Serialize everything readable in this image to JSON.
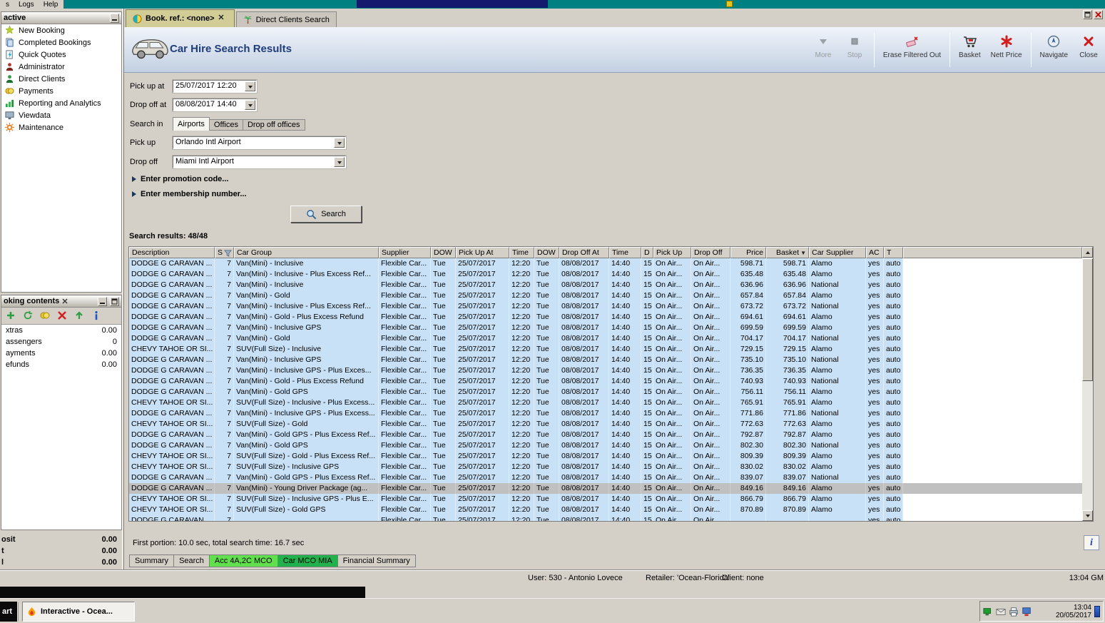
{
  "desktop": {
    "menu": [
      "s",
      "Logs",
      "Help"
    ]
  },
  "window": {
    "controls": [
      "restore-icon",
      "window-close-icon"
    ]
  },
  "tabs": [
    {
      "label": "Book. ref.: <none>",
      "icon": "globe-icon",
      "close_icon": "close-x-icon",
      "active": true
    },
    {
      "label": "Direct Clients Search",
      "icon": "palm-icon",
      "active": false
    }
  ],
  "header": {
    "title": "Car Hire Search Results",
    "image": "car-icon",
    "toolbar": [
      {
        "label": "More",
        "icon": "more-icon",
        "disabled": true
      },
      {
        "label": "Stop",
        "icon": "stop-icon",
        "disabled": true,
        "sep_after": true
      },
      {
        "label": "Erase Filtered Out",
        "icon": "eraser-icon",
        "sep_after": true
      },
      {
        "label": "Basket",
        "icon": "basket-icon"
      },
      {
        "label": "Nett Price",
        "icon": "nett-price-icon",
        "sep_after": true
      },
      {
        "label": "Navigate",
        "icon": "navigate-icon"
      },
      {
        "label": "Close",
        "icon": "close-icon"
      }
    ]
  },
  "form": {
    "pickup_at_label": "Pick up at",
    "pickup_at_value": "25/07/2017 12:20",
    "dropoff_at_label": "Drop off at",
    "dropoff_at_value": "08/08/2017 14:40",
    "search_in_label": "Search in",
    "search_in_tabs": [
      "Airports",
      "Offices",
      "Drop off offices"
    ],
    "search_in_active": 0,
    "pickup_label": "Pick up",
    "pickup_value": "Orlando Intl Airport",
    "dropoff_label": "Drop off",
    "dropoff_value": "Miami Intl Airport",
    "promotion_expander": "Enter promotion code...",
    "membership_expander": "Enter membership number...",
    "search_button": "Search",
    "search_button_icon": "search-icon"
  },
  "results": {
    "summary": "Search results: 48/48",
    "status": "First portion: 10.0 sec, total search time: 16.7 sec",
    "columns": [
      {
        "label": "Description"
      },
      {
        "label": "S",
        "icon": "filter-icon"
      },
      {
        "label": "Car Group"
      },
      {
        "label": "Supplier"
      },
      {
        "label": "DOW"
      },
      {
        "label": "Pick Up At"
      },
      {
        "label": "Time"
      },
      {
        "label": "DOW"
      },
      {
        "label": "Drop Off At"
      },
      {
        "label": "Time"
      },
      {
        "label": "D"
      },
      {
        "label": "Pick Up"
      },
      {
        "label": "Drop Off"
      },
      {
        "label": "Price",
        "align": "right"
      },
      {
        "label": "Basket",
        "align": "right",
        "sort": "desc"
      },
      {
        "label": "Car Supplier"
      },
      {
        "label": "AC"
      },
      {
        "label": "T"
      }
    ],
    "shared": {
      "seats": "7",
      "supplier": "Flexible Car...",
      "pickup_dow": "Tue",
      "pickup_date": "25/07/2017",
      "pickup_time": "12:20",
      "dropoff_dow": "Tue",
      "dropoff_date": "08/08/2017",
      "dropoff_time": "14:40",
      "days": "15",
      "pickup_location": "On Air...",
      "dropoff_location": "On Air...",
      "ac": "yes",
      "transmission": "auto"
    },
    "rows": [
      {
        "desc": "DODGE G CARAVAN ...",
        "group": "Van(Mini) - Inclusive",
        "price": "598.71",
        "basket": "598.71",
        "car": "Alamo"
      },
      {
        "desc": "DODGE G CARAVAN ...",
        "group": "Van(Mini) - Inclusive - Plus Excess Ref...",
        "price": "635.48",
        "basket": "635.48",
        "car": "Alamo"
      },
      {
        "desc": "DODGE G CARAVAN ...",
        "group": "Van(Mini) - Inclusive",
        "price": "636.96",
        "basket": "636.96",
        "car": "National"
      },
      {
        "desc": "DODGE G CARAVAN ...",
        "group": "Van(Mini) - Gold",
        "price": "657.84",
        "basket": "657.84",
        "car": "Alamo"
      },
      {
        "desc": "DODGE G CARAVAN ...",
        "group": "Van(Mini) - Inclusive - Plus Excess Ref...",
        "price": "673.72",
        "basket": "673.72",
        "car": "National"
      },
      {
        "desc": "DODGE G CARAVAN ...",
        "group": "Van(Mini) - Gold - Plus Excess Refund",
        "price": "694.61",
        "basket": "694.61",
        "car": "Alamo"
      },
      {
        "desc": "DODGE G CARAVAN ...",
        "group": "Van(Mini) - Inclusive GPS",
        "price": "699.59",
        "basket": "699.59",
        "car": "Alamo"
      },
      {
        "desc": "DODGE G CARAVAN ...",
        "group": "Van(Mini) - Gold",
        "price": "704.17",
        "basket": "704.17",
        "car": "National"
      },
      {
        "desc": "CHEVY TAHOE OR SI...",
        "group": "SUV(Full Size) - Inclusive",
        "price": "729.15",
        "basket": "729.15",
        "car": "Alamo"
      },
      {
        "desc": "DODGE G CARAVAN ...",
        "group": "Van(Mini) - Inclusive GPS",
        "price": "735.10",
        "basket": "735.10",
        "car": "National"
      },
      {
        "desc": "DODGE G CARAVAN ...",
        "group": "Van(Mini) - Inclusive GPS - Plus Exces...",
        "price": "736.35",
        "basket": "736.35",
        "car": "Alamo"
      },
      {
        "desc": "DODGE G CARAVAN ...",
        "group": "Van(Mini) - Gold - Plus Excess Refund",
        "price": "740.93",
        "basket": "740.93",
        "car": "National"
      },
      {
        "desc": "DODGE G CARAVAN ...",
        "group": "Van(Mini) - Gold GPS",
        "price": "756.11",
        "basket": "756.11",
        "car": "Alamo"
      },
      {
        "desc": "CHEVY TAHOE OR SI...",
        "group": "SUV(Full Size) - Inclusive - Plus Excess...",
        "price": "765.91",
        "basket": "765.91",
        "car": "Alamo"
      },
      {
        "desc": "DODGE G CARAVAN ...",
        "group": "Van(Mini) - Inclusive GPS - Plus Excess...",
        "price": "771.86",
        "basket": "771.86",
        "car": "National"
      },
      {
        "desc": "CHEVY TAHOE OR SI...",
        "group": "SUV(Full Size) - Gold",
        "price": "772.63",
        "basket": "772.63",
        "car": "Alamo"
      },
      {
        "desc": "DODGE G CARAVAN ...",
        "group": "Van(Mini) - Gold GPS - Plus Excess Ref...",
        "price": "792.87",
        "basket": "792.87",
        "car": "Alamo"
      },
      {
        "desc": "DODGE G CARAVAN ...",
        "group": "Van(Mini) - Gold GPS",
        "price": "802.30",
        "basket": "802.30",
        "car": "National"
      },
      {
        "desc": "CHEVY TAHOE OR SI...",
        "group": "SUV(Full Size) - Gold - Plus Excess Ref...",
        "price": "809.39",
        "basket": "809.39",
        "car": "Alamo"
      },
      {
        "desc": "CHEVY TAHOE OR SI...",
        "group": "SUV(Full Size) - Inclusive GPS",
        "price": "830.02",
        "basket": "830.02",
        "car": "Alamo"
      },
      {
        "desc": "DODGE G CARAVAN ...",
        "group": "Van(Mini) - Gold GPS - Plus Excess Ref...",
        "price": "839.07",
        "basket": "839.07",
        "car": "National"
      },
      {
        "desc": "DODGE G CARAVAN ...",
        "group": "Van(Mini) - Young Driver Package (ag...",
        "price": "849.16",
        "basket": "849.16",
        "car": "Alamo",
        "selected": true
      },
      {
        "desc": "CHEVY TAHOE OR SI...",
        "group": "SUV(Full Size) - Inclusive GPS - Plus E...",
        "price": "866.79",
        "basket": "866.79",
        "car": "Alamo"
      },
      {
        "desc": "CHEVY TAHOE OR SI...",
        "group": "SUV(Full Size) - Gold GPS",
        "price": "870.89",
        "basket": "870.89",
        "car": "Alamo"
      },
      {
        "desc": "DODGE G CARAVAN ...",
        "group": "",
        "price": "",
        "basket": "",
        "car": "",
        "partial": true
      }
    ]
  },
  "sidebar": {
    "title": "active",
    "items": [
      {
        "label": "New Booking",
        "icon": "new-booking-icon"
      },
      {
        "label": "Completed Bookings",
        "icon": "completed-bookings-icon"
      },
      {
        "label": "Quick Quotes",
        "icon": "quick-quotes-icon"
      },
      {
        "label": "Administrator",
        "icon": "administrator-icon"
      },
      {
        "label": "Direct Clients",
        "icon": "direct-clients-icon"
      },
      {
        "label": "Payments",
        "icon": "payments-icon"
      },
      {
        "label": "Reporting and Analytics",
        "icon": "reporting-icon"
      },
      {
        "label": "Viewdata",
        "icon": "viewdata-icon"
      },
      {
        "label": "Maintenance",
        "icon": "maintenance-icon"
      }
    ]
  },
  "booking_contents": {
    "title": "oking contents",
    "window_buttons": [
      "minimize-icon",
      "restore-icon"
    ],
    "toolbar": [
      "add-icon",
      "refresh-icon",
      "money-icon",
      "delete-icon",
      "move-up-icon",
      "info-icon"
    ],
    "rows": [
      {
        "label": "xtras",
        "value": "0.00"
      },
      {
        "label": "assengers",
        "value": "0"
      },
      {
        "label": "ayments",
        "value": "0.00"
      },
      {
        "label": "efunds",
        "value": "0.00"
      }
    ]
  },
  "totals": [
    {
      "label": "osit",
      "value": "0.00"
    },
    {
      "label": "t",
      "value": "0.00"
    },
    {
      "label": "l",
      "value": "0.00"
    }
  ],
  "bottom_tabs": [
    {
      "label": "Summary"
    },
    {
      "label": "Search"
    },
    {
      "label": "Acc 4A,2C MCO",
      "color": "#62df4d"
    },
    {
      "label": "Car MCO MIA",
      "color": "#22b14c"
    },
    {
      "label": "Financial Summary"
    }
  ],
  "statusbar": {
    "user": "User: 530 - Antonio Lovece",
    "retailer": "Retailer: 'Ocean-Florida'",
    "client": "Client: none",
    "time": "13:04 GM"
  },
  "taskbar": {
    "start": "art",
    "task": "Interactive - Ocea...",
    "task_icon": "flame-icon",
    "tray_icons": [
      "network-icon",
      "mail-icon",
      "printer-icon",
      "device-icon"
    ],
    "clock_time": "13:04",
    "clock_date": "20/05/2017"
  },
  "colors": {
    "desktop": "#008080",
    "grid_row": "#c9e1f6",
    "grid_selected": "#c0c0c0",
    "tab_active": "#d2cc96",
    "green_tab_1": "#62df4d",
    "green_tab_2": "#22b14c"
  }
}
